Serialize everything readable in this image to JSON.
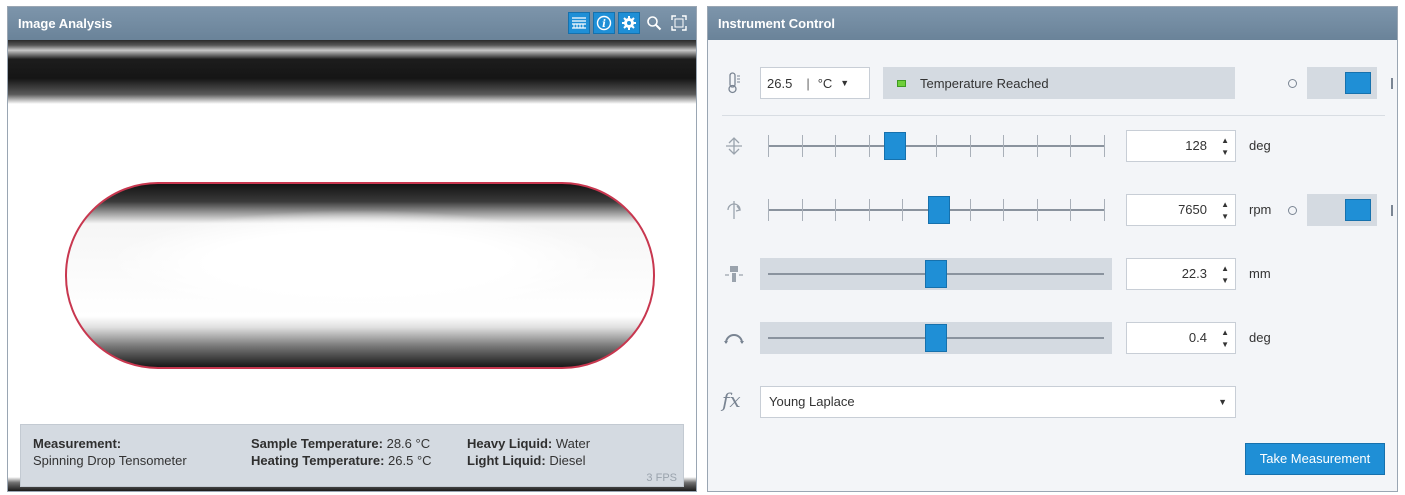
{
  "image_analysis": {
    "title": "Image Analysis",
    "toolbar": [
      {
        "icon": "ruler-icon",
        "active": true
      },
      {
        "icon": "info-icon",
        "active": true
      },
      {
        "icon": "gear-icon",
        "active": true
      },
      {
        "icon": "zoom-icon",
        "active": false
      },
      {
        "icon": "fit-screen-icon",
        "active": false
      }
    ],
    "info": {
      "measurement_label": "Measurement:",
      "measurement_value": "Spinning Drop Tensometer",
      "sample_temp_label": "Sample Temperature:",
      "sample_temp_value": "28.6 °C",
      "heating_temp_label": "Heating Temperature:",
      "heating_temp_value": "26.5 °C",
      "heavy_liquid_label": "Heavy Liquid:",
      "heavy_liquid_value": "Water",
      "light_liquid_label": "Light Liquid:",
      "light_liquid_value": "Diesel",
      "fps": "3 FPS"
    },
    "colors": {
      "contour": "#c8374f"
    }
  },
  "instrument_control": {
    "title": "Instrument Control",
    "temperature": {
      "value": "26.5",
      "unit": "°C",
      "status": "Temperature Reached",
      "heater_on": true
    },
    "tilt": {
      "value": "128",
      "unit": "deg",
      "position": 0.37
    },
    "speed": {
      "value": "7650",
      "unit": "rpm",
      "position": 0.51,
      "motor_on": true
    },
    "position": {
      "value": "22.3",
      "unit": "mm",
      "position": 0.5
    },
    "angle": {
      "value": "0.4",
      "unit": "deg",
      "position": 0.5
    },
    "method": {
      "selected": "Young Laplace"
    },
    "take_measurement_label": "Take Measurement"
  },
  "colors": {
    "accent": "#1f8fd6",
    "titlebar": "#7189a0",
    "shaded": "#d4dae1"
  }
}
